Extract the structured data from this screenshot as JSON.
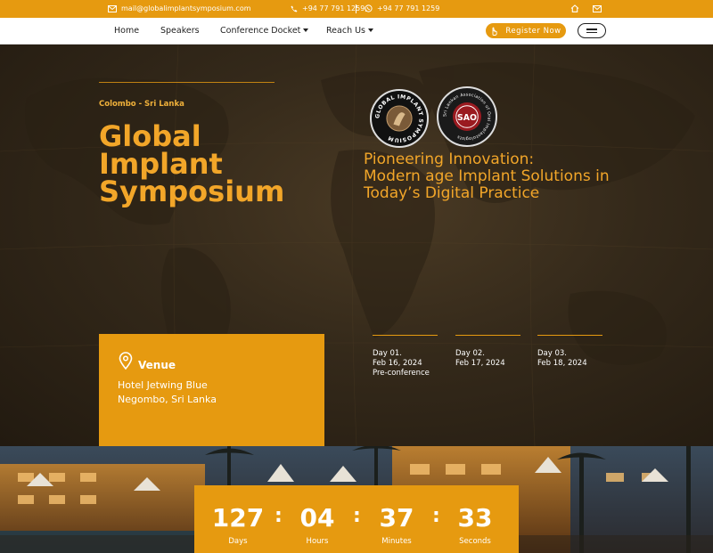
{
  "topbar": {
    "email": "mail@globalimplantsymposium.com",
    "phone": "+94 77 791 1259",
    "whatsapp": "+94 77 791 1259"
  },
  "nav": {
    "items": [
      "Home",
      "Speakers",
      "Conference Docket",
      "Reach Us"
    ],
    "register_label": "Register Now"
  },
  "hero": {
    "location": "Colombo - Sri Lanka",
    "title_lines": [
      "Global",
      "Implant",
      "Symposium"
    ],
    "subtitle_lines": [
      "Pioneering Innovation:",
      "Modern age Implant Solutions in",
      "Today’s Digital Practice"
    ],
    "logos": {
      "left_ring_text": "GLOBAL IMPLANT SYMPOSIUM",
      "right_ring_text": "Sri Lankan Association of Oral Implantologists",
      "right_center": "SAO"
    }
  },
  "schedule": [
    {
      "day": "Day 01.",
      "date": "Feb 16, 2024",
      "note": "Pre-conference"
    },
    {
      "day": "Day 02.",
      "date": "Feb 17, 2024",
      "note": ""
    },
    {
      "day": "Day 03.",
      "date": "Feb 18, 2024",
      "note": ""
    }
  ],
  "venue": {
    "label": "Venue",
    "line1": "Hotel Jetwing Blue",
    "line2": "Negombo, Sri Lanka"
  },
  "countdown": [
    {
      "value": "127",
      "label": "Days"
    },
    {
      "value": "04",
      "label": "Hours"
    },
    {
      "value": "37",
      "label": "Minutes"
    },
    {
      "value": "33",
      "label": "Seconds"
    }
  ],
  "colors": {
    "accent": "#e69a10",
    "title": "#f2a629"
  }
}
